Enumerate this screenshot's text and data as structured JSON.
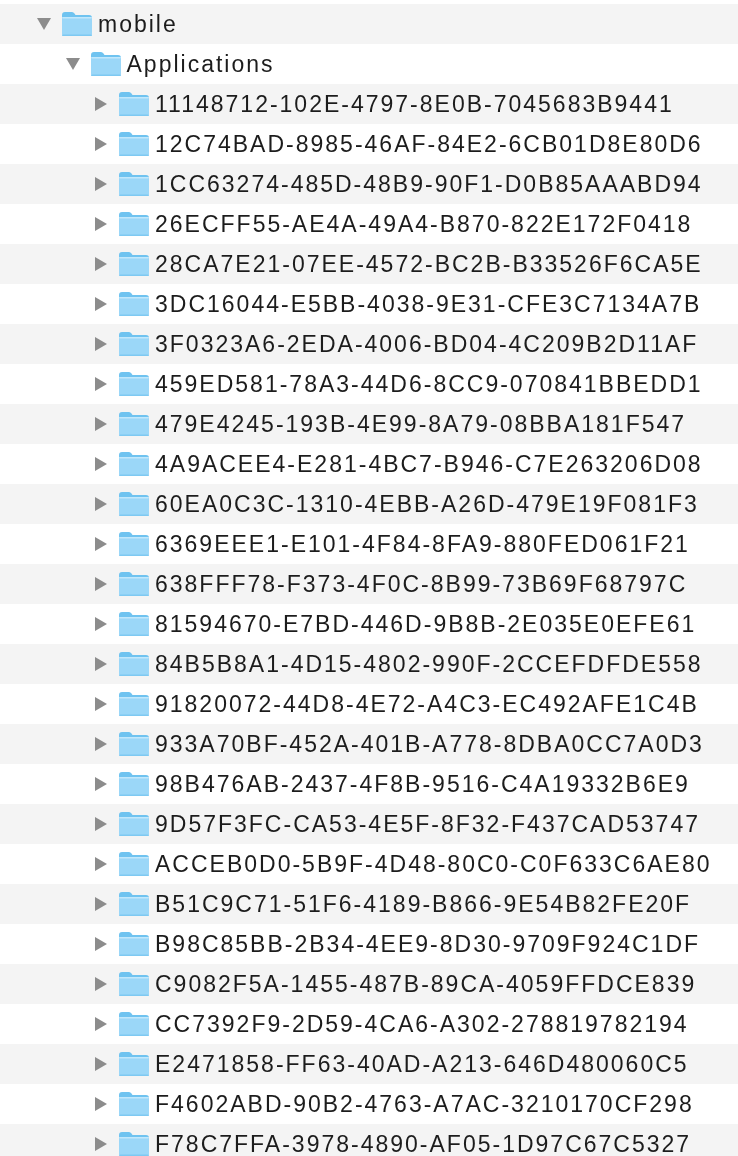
{
  "tree": [
    {
      "name": "mobile",
      "expanded": true,
      "children": [
        {
          "name": "Applications",
          "expanded": true,
          "children": [
            {
              "name": "11148712-102E-4797-8E0B-7045683B9441",
              "expanded": false
            },
            {
              "name": "12C74BAD-8985-46AF-84E2-6CB01D8E80D6",
              "expanded": false
            },
            {
              "name": "1CC63274-485D-48B9-90F1-D0B85AAABD94",
              "expanded": false
            },
            {
              "name": "26ECFF55-AE4A-49A4-B870-822E172F0418",
              "expanded": false
            },
            {
              "name": "28CA7E21-07EE-4572-BC2B-B33526F6CA5E",
              "expanded": false
            },
            {
              "name": "3DC16044-E5BB-4038-9E31-CFE3C7134A7B",
              "expanded": false
            },
            {
              "name": "3F0323A6-2EDA-4006-BD04-4C209B2D11AF",
              "expanded": false
            },
            {
              "name": "459ED581-78A3-44D6-8CC9-070841BBEDD1",
              "expanded": false
            },
            {
              "name": "479E4245-193B-4E99-8A79-08BBA181F547",
              "expanded": false
            },
            {
              "name": "4A9ACEE4-E281-4BC7-B946-C7E263206D08",
              "expanded": false
            },
            {
              "name": "60EA0C3C-1310-4EBB-A26D-479E19F081F3",
              "expanded": false
            },
            {
              "name": "6369EEE1-E101-4F84-8FA9-880FED061F21",
              "expanded": false
            },
            {
              "name": "638FFF78-F373-4F0C-8B99-73B69F68797C",
              "expanded": false
            },
            {
              "name": "81594670-E7BD-446D-9B8B-2E035E0EFE61",
              "expanded": false
            },
            {
              "name": "84B5B8A1-4D15-4802-990F-2CCEFDFDE558",
              "expanded": false
            },
            {
              "name": "91820072-44D8-4E72-A4C3-EC492AFE1C4B",
              "expanded": false
            },
            {
              "name": "933A70BF-452A-401B-A778-8DBA0CC7A0D3",
              "expanded": false
            },
            {
              "name": "98B476AB-2437-4F8B-9516-C4A19332B6E9",
              "expanded": false
            },
            {
              "name": "9D57F3FC-CA53-4E5F-8F32-F437CAD53747",
              "expanded": false
            },
            {
              "name": "ACCEB0D0-5B9F-4D48-80C0-C0F633C6AE80",
              "expanded": false
            },
            {
              "name": "B51C9C71-51F6-4189-B866-9E54B82FE20F",
              "expanded": false
            },
            {
              "name": "B98C85BB-2B34-4EE9-8D30-9709F924C1DF",
              "expanded": false
            },
            {
              "name": "C9082F5A-1455-487B-89CA-4059FFDCE839",
              "expanded": false
            },
            {
              "name": "CC7392F9-2D59-4CA6-A302-278819782194",
              "expanded": false
            },
            {
              "name": "E2471858-FF63-40AD-A213-646D480060C5",
              "expanded": false
            },
            {
              "name": "F4602ABD-90B2-4763-A7AC-3210170CF298",
              "expanded": false
            },
            {
              "name": "F78C7FFA-3978-4890-AF05-1D97C67C5327",
              "expanded": false
            }
          ]
        }
      ]
    }
  ]
}
